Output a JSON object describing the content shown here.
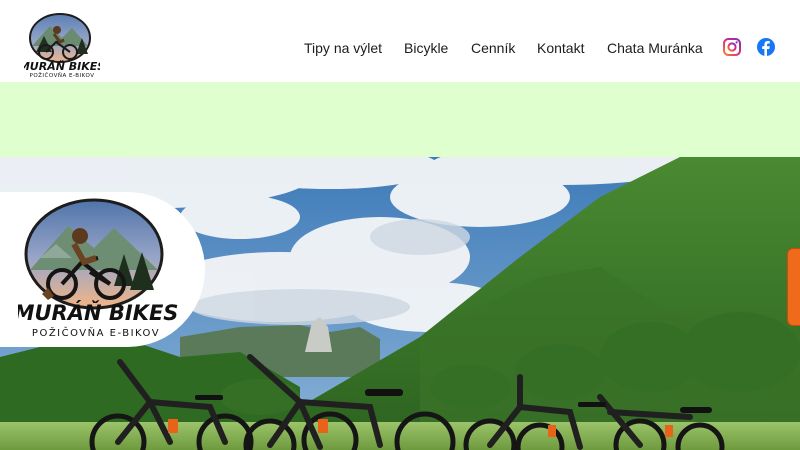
{
  "brand": {
    "name": "MURÁŇ BIKES",
    "tagline": "POŽIČOVŇA E-BIKOV"
  },
  "nav": {
    "items": [
      {
        "label": "Tipy na výlet"
      },
      {
        "label": "Bicykle"
      },
      {
        "label": "Cenník"
      },
      {
        "label": "Kontakt"
      },
      {
        "label": "Chata Muránka"
      }
    ]
  },
  "social": {
    "instagram_icon": "instagram-icon",
    "facebook_icon": "facebook-icon"
  },
  "colors": {
    "band": "#dfffcf",
    "accent_orange": "#ef6b1b",
    "instagram": "#8a3ab9",
    "facebook": "#1877f2"
  }
}
